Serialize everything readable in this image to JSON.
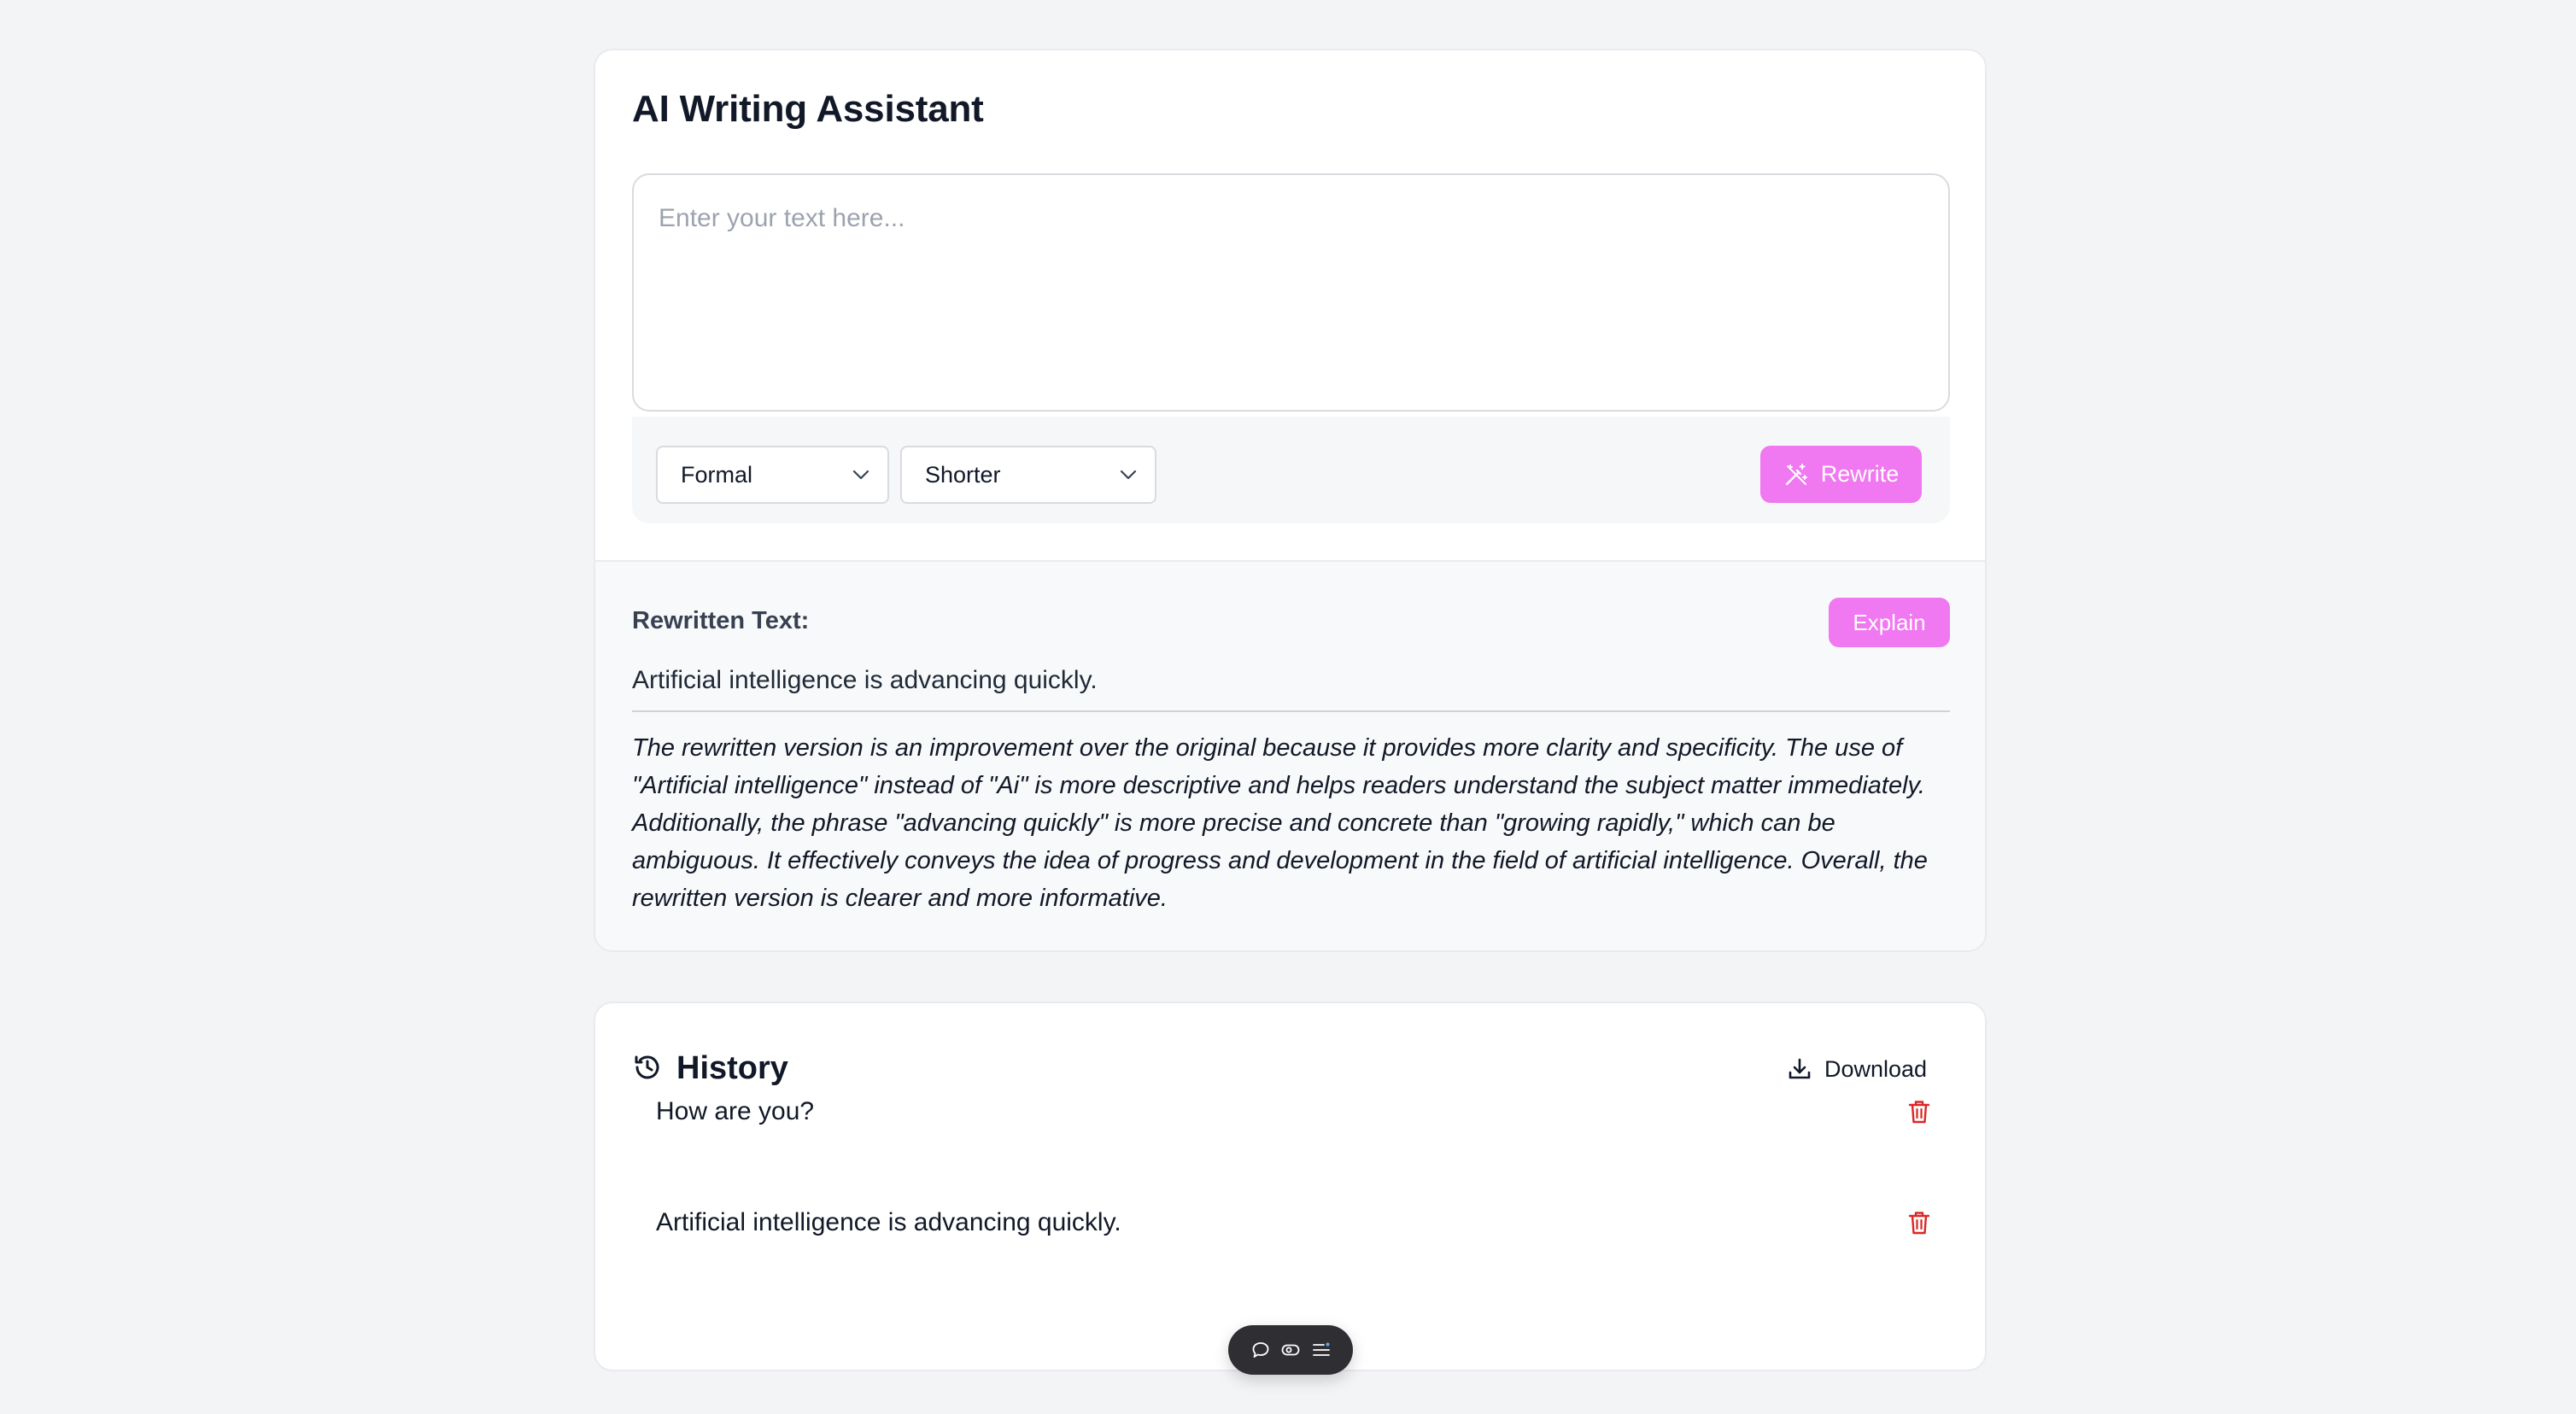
{
  "app": {
    "title": "AI Writing Assistant"
  },
  "editor": {
    "placeholder": "Enter your text here...",
    "value": ""
  },
  "controls": {
    "tone": {
      "selected": "Formal"
    },
    "length": {
      "selected": "Shorter"
    },
    "rewrite_label": "Rewrite",
    "rewrite_icon": "magic-wand-icon",
    "accent_color": "#f078f0"
  },
  "result": {
    "label": "Rewritten Text:",
    "explain_label": "Explain",
    "text": "Artificial intelligence is advancing quickly.",
    "explanation": "The rewritten version is an improvement over the original because it provides more clarity and specificity. The use of \"Artificial intelligence\" instead of \"Ai\" is more descriptive and helps readers understand the subject matter immediately. Additionally, the phrase \"advancing quickly\" is more precise and concrete than \"growing rapidly,\" which can be ambiguous. It effectively conveys the idea of progress and development in the field of artificial intelligence. Overall, the rewritten version is clearer and more informative."
  },
  "history": {
    "title": "History",
    "icon": "history-icon",
    "download_label": "Download",
    "download_icon": "download-icon",
    "delete_icon": "trash-icon",
    "delete_color": "#dc2626",
    "items": [
      {
        "text": "How are you?"
      },
      {
        "text": "Artificial intelligence is advancing quickly."
      }
    ]
  },
  "floating_toolbar": {
    "icons": [
      "comment-icon",
      "eye-icon",
      "menu-icon"
    ]
  }
}
